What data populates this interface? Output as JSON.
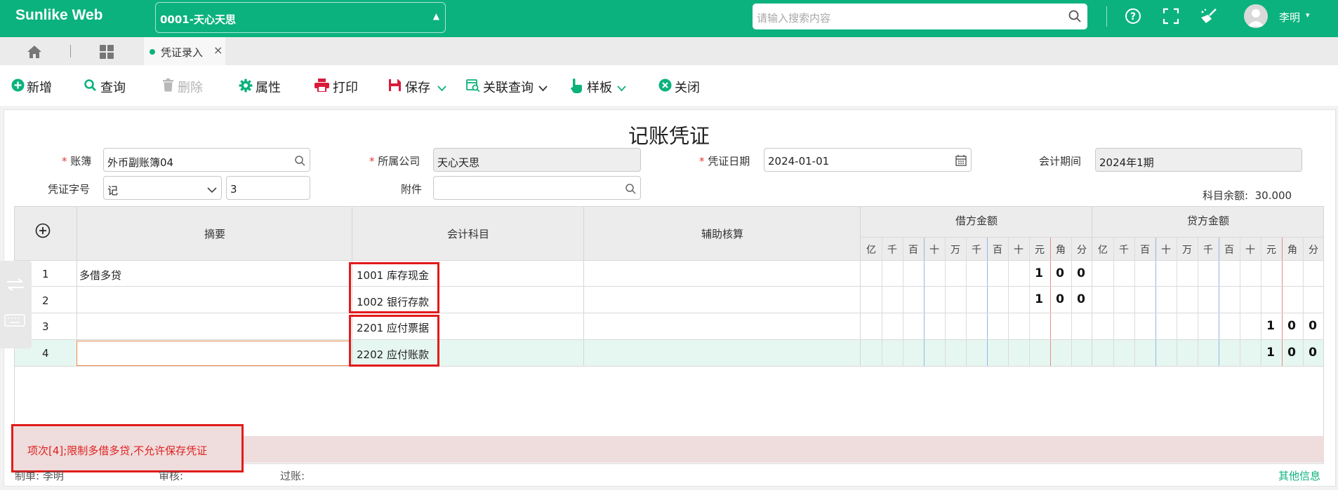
{
  "header": {
    "brand": "Sunlike Web",
    "account_selector": "0001-天心天思",
    "search_placeholder": "请输入搜索内容",
    "user_name": "李明"
  },
  "tabs": [
    {
      "label": "凭证录入",
      "active": true
    }
  ],
  "toolbar": {
    "add": "新增",
    "query": "查询",
    "delete": "删除",
    "properties": "属性",
    "print": "打印",
    "save": "保存",
    "related_query": "关联查询",
    "template": "样板",
    "close": "关闭"
  },
  "form": {
    "title": "记账凭证",
    "ledger_label": "账簿",
    "ledger_value": "外币副账簿04",
    "company_label": "所属公司",
    "company_value": "天心天思",
    "date_label": "凭证日期",
    "date_value": "2024-01-01",
    "period_label": "会计期间",
    "period_value": "2024年1期",
    "voucher_type_label": "凭证字号",
    "voucher_type_value": "记",
    "voucher_number": "3",
    "attachment_label": "附件",
    "attachment_value": "",
    "balance_label": "科目余额:",
    "balance_value": "30.000"
  },
  "grid": {
    "columns": {
      "summary": "摘要",
      "account": "会计科目",
      "auxiliary": "辅助核算",
      "debit": "借方金额",
      "credit": "贷方金额"
    },
    "digit_units": [
      "亿",
      "千",
      "百",
      "十",
      "万",
      "千",
      "百",
      "十",
      "元",
      "角",
      "分"
    ],
    "rows": [
      {
        "no": "1",
        "summary": "多借多贷",
        "account": "1001 库存现金",
        "auxiliary": "",
        "debit_digits": [
          "1",
          "0",
          "0"
        ],
        "credit_digits": []
      },
      {
        "no": "2",
        "summary": "",
        "account": "1002 银行存款",
        "auxiliary": "",
        "debit_digits": [
          "1",
          "0",
          "0"
        ],
        "credit_digits": []
      },
      {
        "no": "3",
        "summary": "",
        "account": "2201 应付票据",
        "auxiliary": "",
        "debit_digits": [],
        "credit_digits": [
          "1",
          "0",
          "0"
        ]
      },
      {
        "no": "4",
        "summary": "",
        "account": "2202 应付账款",
        "auxiliary": "",
        "debit_digits": [],
        "credit_digits": [
          "1",
          "0",
          "0"
        ]
      }
    ]
  },
  "error_message": "项次[4];限制多借多贷,不允许保存凭证",
  "footer": {
    "maker_label": "制单:",
    "maker_value": "李明",
    "reviewer_label": "审核:",
    "poster_label": "过账:",
    "other_info": "其他信息"
  },
  "colors": {
    "brand": "#0cb27d",
    "error": "#e21b1b",
    "active_row": "#e6f6f1"
  }
}
